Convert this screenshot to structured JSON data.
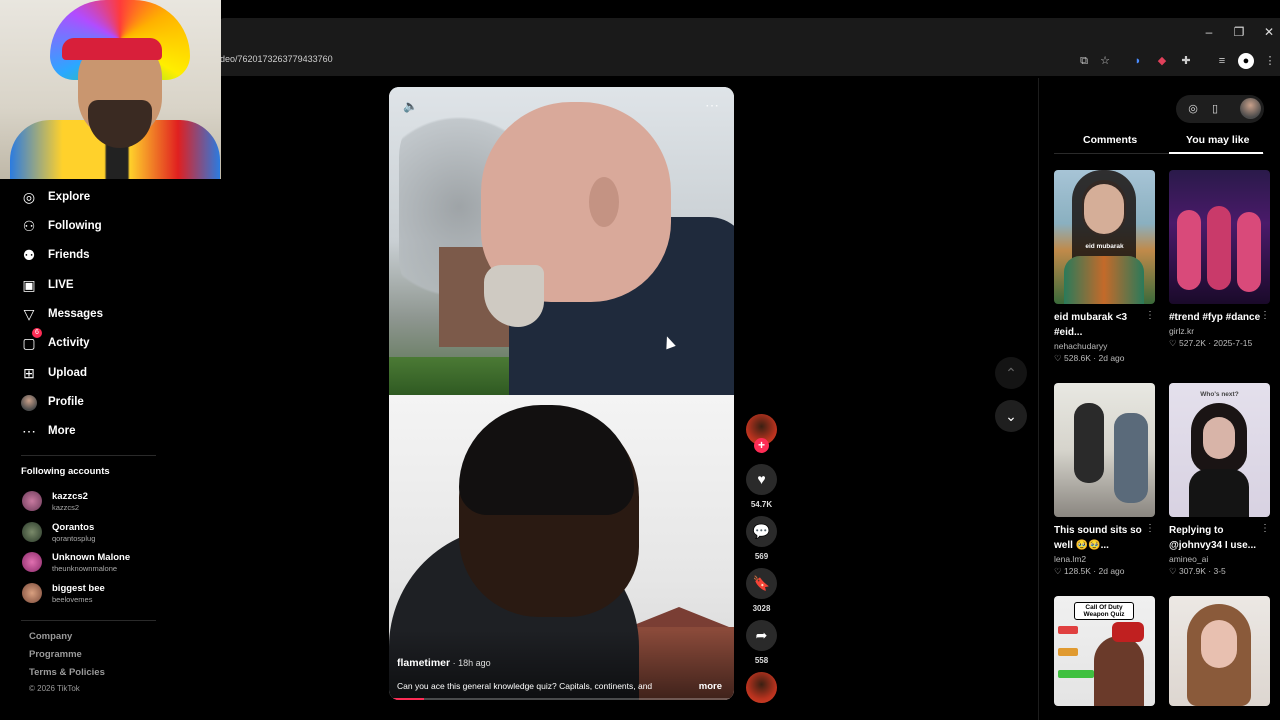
{
  "browser": {
    "url": "deo/7620173263779433760",
    "window_controls": [
      "–",
      "❐",
      "✕"
    ]
  },
  "sidebar": {
    "items": [
      {
        "label": "Explore",
        "icon": "compass-icon"
      },
      {
        "label": "Following",
        "icon": "following-icon"
      },
      {
        "label": "Friends",
        "icon": "friends-icon"
      },
      {
        "label": "LIVE",
        "icon": "live-icon"
      },
      {
        "label": "Messages",
        "icon": "messages-icon"
      },
      {
        "label": "Activity",
        "icon": "activity-icon",
        "badge": "6"
      },
      {
        "label": "Upload",
        "icon": "upload-icon"
      },
      {
        "label": "Profile",
        "icon": "profile-icon"
      },
      {
        "label": "More",
        "icon": "more-icon"
      }
    ],
    "following_heading": "Following accounts",
    "accounts": [
      {
        "name": "kazzcs2",
        "handle": "kazzcs2"
      },
      {
        "name": "Qorantos",
        "handle": "qorantosplug"
      },
      {
        "name": "Unknown Malone",
        "handle": "theunknownmalone"
      },
      {
        "name": "biggest bee",
        "handle": "beelovemes"
      }
    ],
    "footer_links": [
      "Company",
      "Programme",
      "Terms & Policies"
    ],
    "copyright": "© 2026 TikTok"
  },
  "video": {
    "author": "flametimer",
    "age": " · 18h ago",
    "caption": "Can you ace this general knowledge quiz? Capitals, continents, and",
    "more": "more",
    "progress": 0.1
  },
  "actions": {
    "likes": "54.7K",
    "comments": "569",
    "saves": "3028",
    "shares": "558"
  },
  "right_panel": {
    "tabs": [
      "Comments",
      "You may like"
    ],
    "active_tab": "You may like",
    "cards": [
      {
        "title": "eid mubarak <3 #eid...",
        "author": "nehachudaryy",
        "likes": "528.6K",
        "date": "2d ago",
        "thumb_text": "eid mubarak"
      },
      {
        "title": "#trend #fyp #dance",
        "author": "girlz.kr",
        "likes": "527.2K",
        "date": "2025-7-15",
        "thumb_text": ""
      },
      {
        "title": "This sound sits so well 🥹🥹...",
        "author": "lena.lm2",
        "likes": "128.5K",
        "date": "2d ago",
        "thumb_text": ""
      },
      {
        "title": "Replying to @johnvy34 I use...",
        "author": "amineo_ai",
        "likes": "307.9K",
        "date": "3-5",
        "thumb_text": "Who's next?"
      },
      {
        "title": "",
        "author": "",
        "likes": "",
        "date": "",
        "thumb_text": "Call Of Duty Weapon Quiz"
      },
      {
        "title": "",
        "author": "",
        "likes": "",
        "date": "",
        "thumb_text": ""
      }
    ]
  },
  "colors": {
    "accent": "#fe2c55",
    "background": "#000000"
  }
}
